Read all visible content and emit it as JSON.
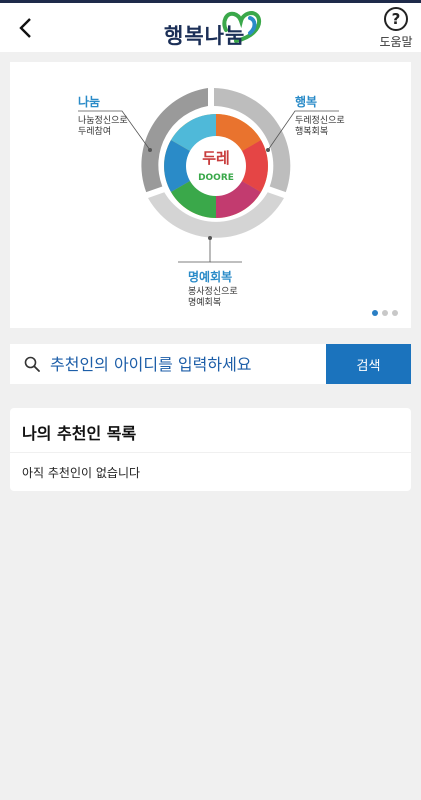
{
  "header": {
    "logo_text": "행복나눔",
    "help_label": "도움말"
  },
  "banner": {
    "center_top": "두레",
    "center_bottom": "DOORE",
    "segments": [
      {
        "title": "나눔",
        "desc_line1": "나눔정신으로",
        "desc_line2": "두레참여"
      },
      {
        "title": "행복",
        "desc_line1": "두레정신으로",
        "desc_line2": "행복회복"
      },
      {
        "title": "명예회복",
        "desc_line1": "봉사정신으로",
        "desc_line2": "명예회복"
      }
    ],
    "page_count": 3,
    "active_page": 1
  },
  "search": {
    "placeholder": "추천인의 아이디를 입력하세요",
    "button_label": "검색"
  },
  "recommenders": {
    "title": "나의 추천인 목록",
    "empty_message": "아직 추천인이 없습니다"
  },
  "colors": {
    "brand_navy": "#1b2f57",
    "accent_blue": "#1b73bd",
    "highlight_blue": "#2a8bc8"
  }
}
